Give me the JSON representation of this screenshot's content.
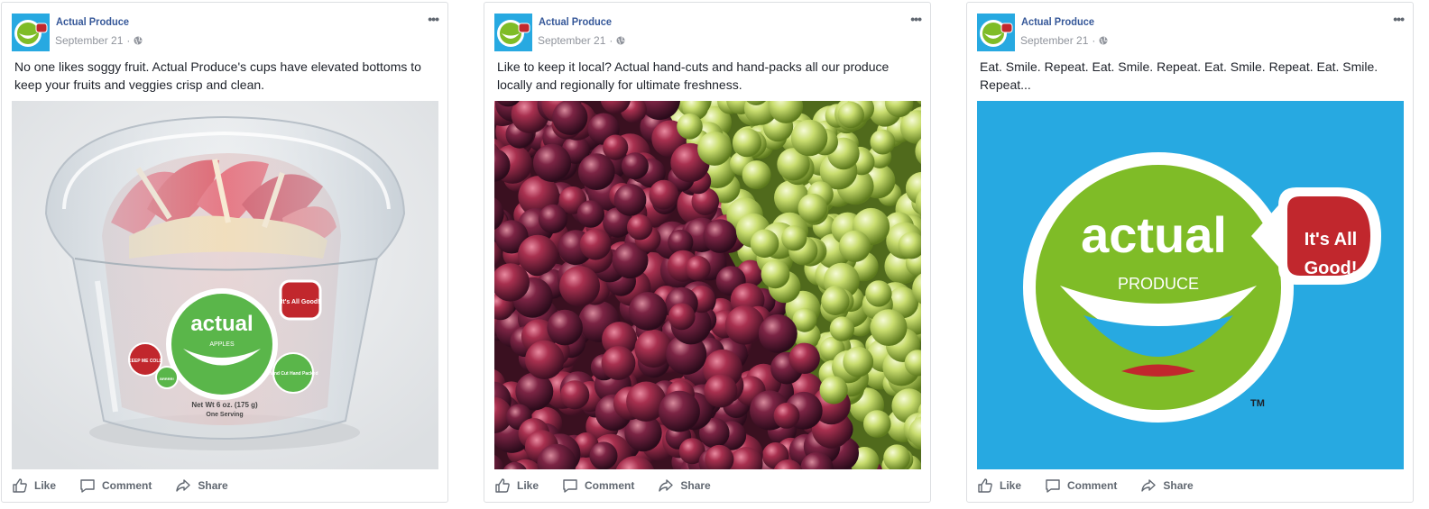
{
  "posts": [
    {
      "page_name": "Actual Produce",
      "date": "September 21",
      "separator": "·",
      "text": "No one likes soggy fruit. Actual Produce's cups have elevated bottoms to keep your fruits and veggies crisp and clean.",
      "image": {
        "logo_word": "actual",
        "logo_sub": "APPLES",
        "bubble": "It's All Good!",
        "side_badge": "KEEP ME COLD",
        "side_badge2": "BRRRR!",
        "corner_badge": "Hand Cut Hand Packed",
        "weight": "Net Wt 6 oz. (175 g)",
        "serving": "One Serving"
      }
    },
    {
      "page_name": "Actual Produce",
      "date": "September 21",
      "separator": "·",
      "text": "Like to keep it local? Actual hand-cuts and hand-packs all our produce locally and regionally for ultimate freshness."
    },
    {
      "page_name": "Actual Produce",
      "date": "September 21",
      "separator": "·",
      "text": "Eat. Smile. Repeat. Eat. Smile. Repeat. Eat. Smile. Repeat. Eat. Smile. Repeat...",
      "image": {
        "logo_word": "actual",
        "logo_sub": "PRODUCE",
        "bubble_line1": "It's All",
        "bubble_line2": "Good!",
        "tm": "TM"
      }
    }
  ],
  "actions": {
    "like": "Like",
    "comment": "Comment",
    "share": "Share"
  },
  "icons": [
    "more-icon",
    "globe-icon",
    "like-icon",
    "comment-icon",
    "share-icon"
  ],
  "colors": {
    "brand_blue": "#27a9e1",
    "brand_green": "#7fbc27",
    "brand_red": "#c1272d",
    "link_blue": "#365899",
    "muted": "#90949c"
  }
}
